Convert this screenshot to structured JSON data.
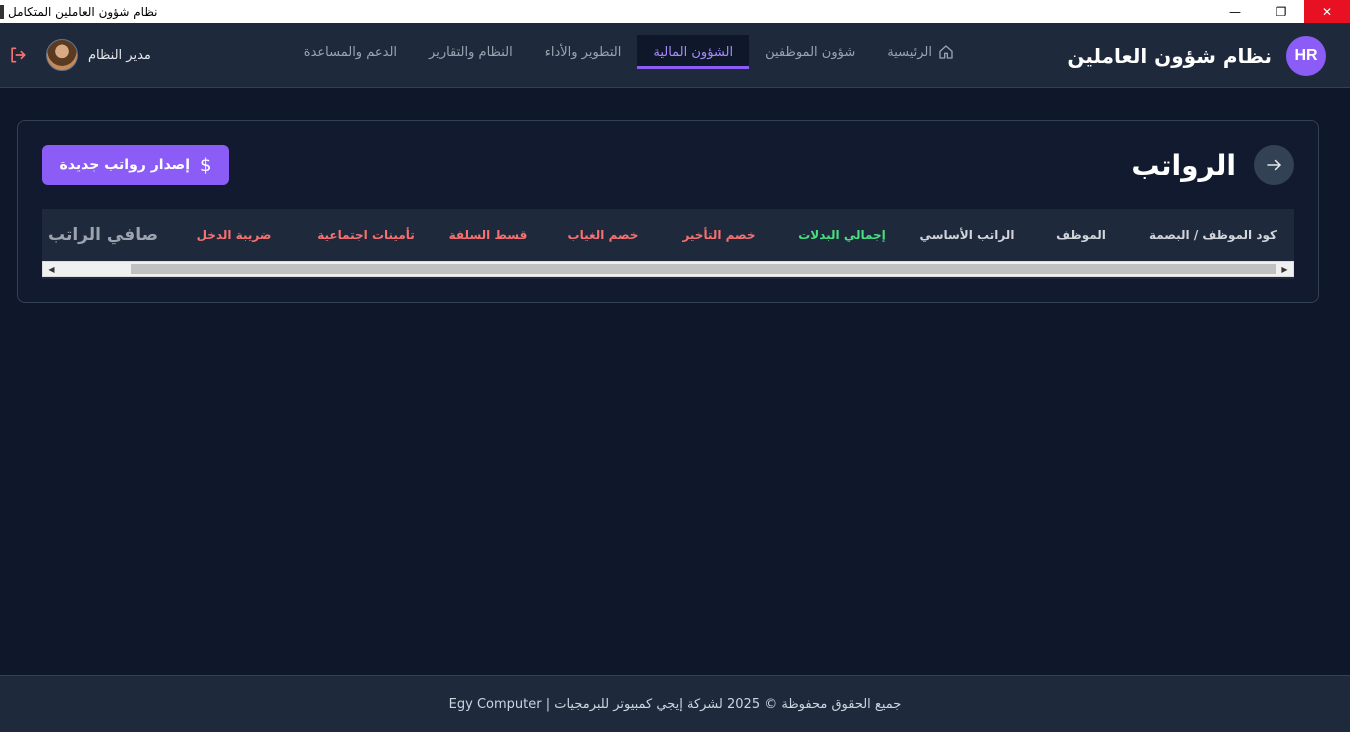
{
  "window": {
    "title": "نظام شؤون العاملين المتكامل",
    "controls": {
      "minimize": "—",
      "maximize": "❐",
      "close": "✕"
    }
  },
  "header": {
    "logo_text": "HR",
    "app_name": "نظام شؤون العاملين",
    "nav": [
      {
        "label": "الرئيسية",
        "icon": "home-icon"
      },
      {
        "label": "شؤون الموظفين"
      },
      {
        "label": "الشؤون المالية",
        "active": true
      },
      {
        "label": "التطوير والأداء"
      },
      {
        "label": "النظام والتقارير"
      },
      {
        "label": "الدعم والمساعدة"
      }
    ],
    "user": {
      "name": "مدير النظام",
      "avatar": "avatar",
      "logout_icon": "logout-icon"
    }
  },
  "page": {
    "title": "الرواتب",
    "back_icon": "arrow-right-icon",
    "issue_button": {
      "label": "إصدار رواتب جديدة",
      "icon": "dollar-icon"
    },
    "table": {
      "columns": [
        "كود الموظف / البصمة",
        "الموظف",
        "الراتب الأساسي",
        "إجمالي البدلات",
        "خصم التأخير",
        "خصم الغياب",
        "قسط السلفة",
        "تأمينات اجتماعية",
        "ضريبة الدخل",
        "صافي الراتب"
      ],
      "rows": []
    }
  },
  "footer": {
    "text": "جميع الحقوق محفوظة © 2025 لشركة إيجي كمبيوتر للبرمجيات | Egy Computer"
  },
  "colors": {
    "accent": "#8b5cf6",
    "positive": "#4ade80",
    "negative": "#f87171",
    "background": "#0f172a",
    "surface": "#1e293b"
  }
}
